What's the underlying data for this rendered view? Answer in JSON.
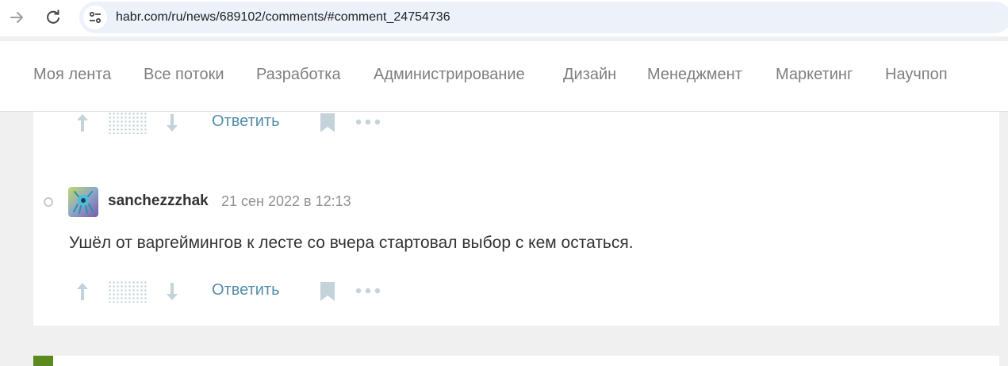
{
  "browser": {
    "url": "habr.com/ru/news/689102/comments/#comment_24754736",
    "forward_icon": "arrow-right-icon",
    "reload_icon": "reload-icon",
    "site_info_icon": "tune-icon"
  },
  "nav": {
    "items": [
      {
        "label": "Моя лента"
      },
      {
        "label": "Все потоки"
      },
      {
        "label": "Разработка"
      },
      {
        "label": "Администрирование"
      },
      {
        "label": "Дизайн"
      },
      {
        "label": "Менеджмент"
      },
      {
        "label": "Маркетинг"
      },
      {
        "label": "Научпоп"
      }
    ]
  },
  "previous_comment": {
    "reply_label": "Ответить"
  },
  "comment": {
    "author": "sanchezzzhak",
    "timestamp": "21 сен 2022 в 12:13",
    "text": "Ушёл от варгеймингов к лесте со вчера стартовал выбор с кем остаться.",
    "reply_label": "Ответить"
  },
  "colors": {
    "accent": "#548eaa",
    "icon": "#c4d2da",
    "text": "#333333",
    "muted": "#909090",
    "background": "#f0f0f0"
  }
}
